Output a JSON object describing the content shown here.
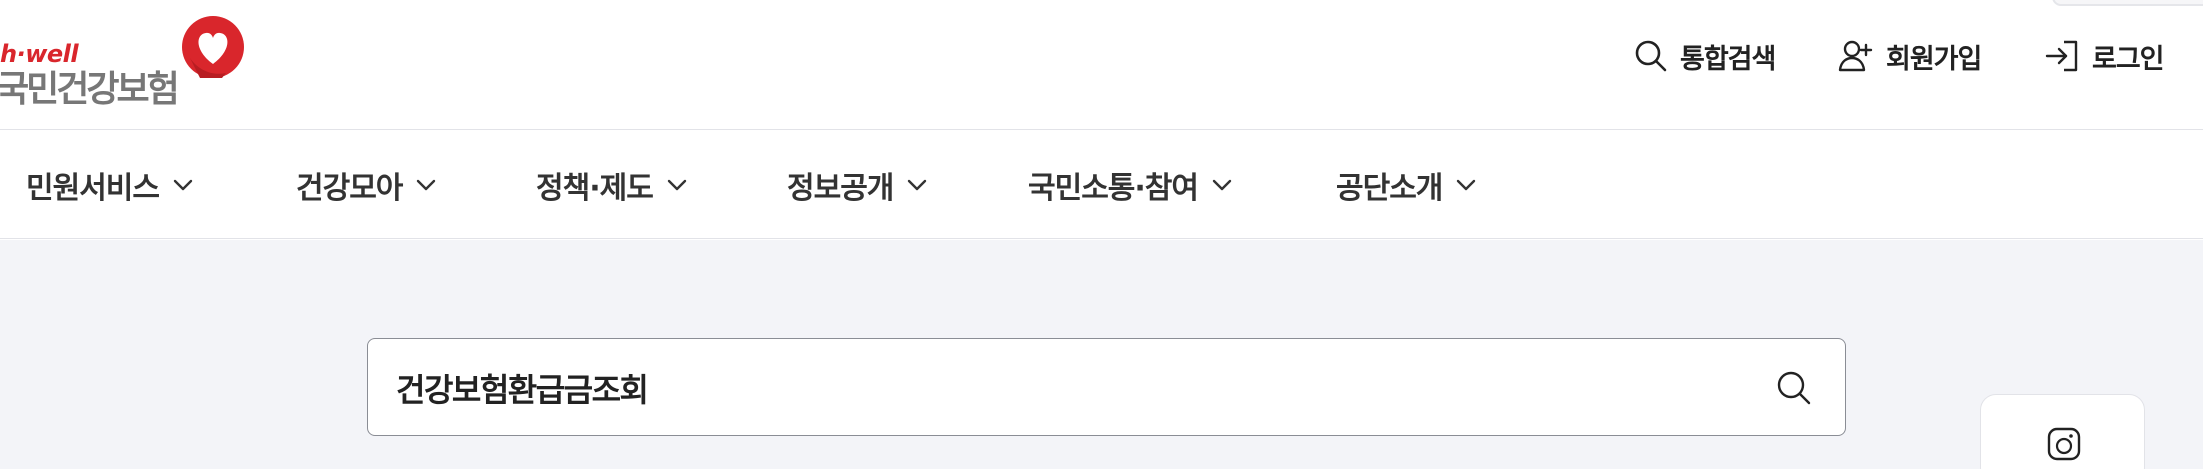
{
  "logo": {
    "eng": "h·well",
    "kor": "국민건강보험"
  },
  "util": {
    "search_label": "통합검색",
    "join_label": "회원가입",
    "login_label": "로그인"
  },
  "gnb": {
    "items": [
      {
        "label": "민원서비스"
      },
      {
        "label": "건강모아"
      },
      {
        "label": "정책·제도"
      },
      {
        "label": "정보공개"
      },
      {
        "label": "국민소통·참여"
      },
      {
        "label": "공단소개"
      }
    ]
  },
  "search": {
    "value": "건강보험환급금조회"
  },
  "icons": {
    "util_search": "search-icon",
    "util_join": "user-plus-icon",
    "util_login": "login-icon",
    "nav_chevron": "chevron-down-icon",
    "search_button": "search-icon",
    "quick_card": "app-icon"
  },
  "colors": {
    "brand_red": "#d9262c",
    "logo_gray": "#777777",
    "background": "#f3f4f8"
  }
}
